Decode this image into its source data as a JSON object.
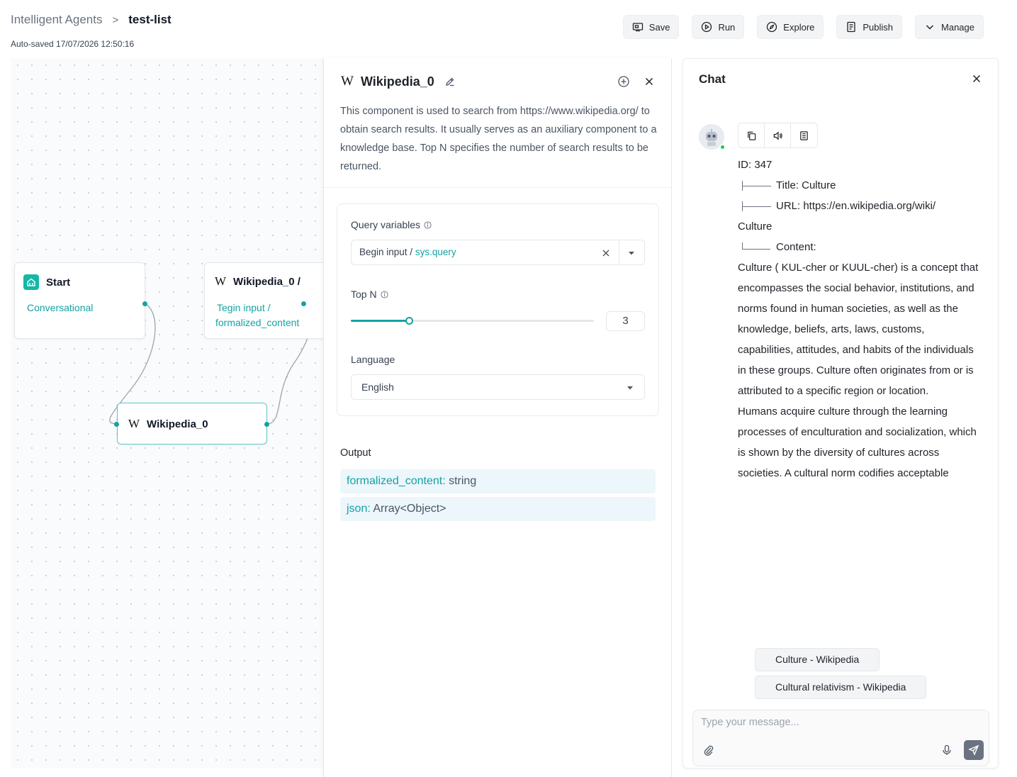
{
  "header": {
    "breadcrumb_root": "Intelligent Agents",
    "breadcrumb_sep": ">",
    "breadcrumb_current": "test-list",
    "autosave": "Auto-saved 17/07/2026 12:50:16",
    "toolbar": {
      "save": "Save",
      "run": "Run",
      "explore": "Explore",
      "publish": "Publish",
      "manage": "Manage"
    }
  },
  "canvas": {
    "start_node": {
      "title": "Start",
      "subtitle": "Conversational"
    },
    "wiki_ref_node": {
      "title": "Wikipedia_0 /",
      "line1": "Tegin input /",
      "line2": "formalized_content"
    },
    "wiki_node": {
      "title": "Wikipedia_0"
    }
  },
  "panel": {
    "title": "Wikipedia_0",
    "description": "This component is used to search from https://www.wikipedia.org/ to obtain search results. It usually serves as an auxiliary component to a knowledge base. Top N specifies the number of search results to be returned.",
    "query_label": "Query variables",
    "query_prefix": "Begin input / ",
    "query_var": "sys.query",
    "topn_label": "Top N",
    "topn_value": "3",
    "topn_fraction": 0.24,
    "language_label": "Language",
    "language_value": "English",
    "output_label": "Output",
    "outputs": [
      {
        "key": "formalized_content:",
        "type": " string"
      },
      {
        "key": "json:",
        "type": " Array<Object>"
      }
    ]
  },
  "chat": {
    "title": "Chat",
    "message": {
      "id_line": "ID: 347",
      "title_line": "Title: Culture",
      "url_line": "URL: https://en.wikipedia.org/wiki/",
      "url_cont": "Culture",
      "content_line": "Content:",
      "paragraph1": "Culture ( KUL-cher or KUUL-cher) is a concept that encompasses the social behavior, institutions, and norms found in human societies, as well as the knowledge, beliefs, arts, laws, customs, capabilities, attitudes, and habits of the individuals in these groups. Culture often originates from or is attributed to a specific region or location.",
      "paragraph2": "Humans acquire culture through the learning processes of enculturation and socialization, which is shown by the diversity of cultures across societies. A cultural norm codifies acceptable conduct in society; it serves as a guideline for behavior, dress, language, and demeanor in a situation, which serves as a template for expectations in a social group. Accepting only a monoculture in a social group can bear risks, just as a single species can wither in the face of environmental change, for"
    },
    "references": [
      "Culture - Wikipedia",
      "Cultural relativism - Wikipedia"
    ],
    "input_placeholder": "Type your message..."
  }
}
